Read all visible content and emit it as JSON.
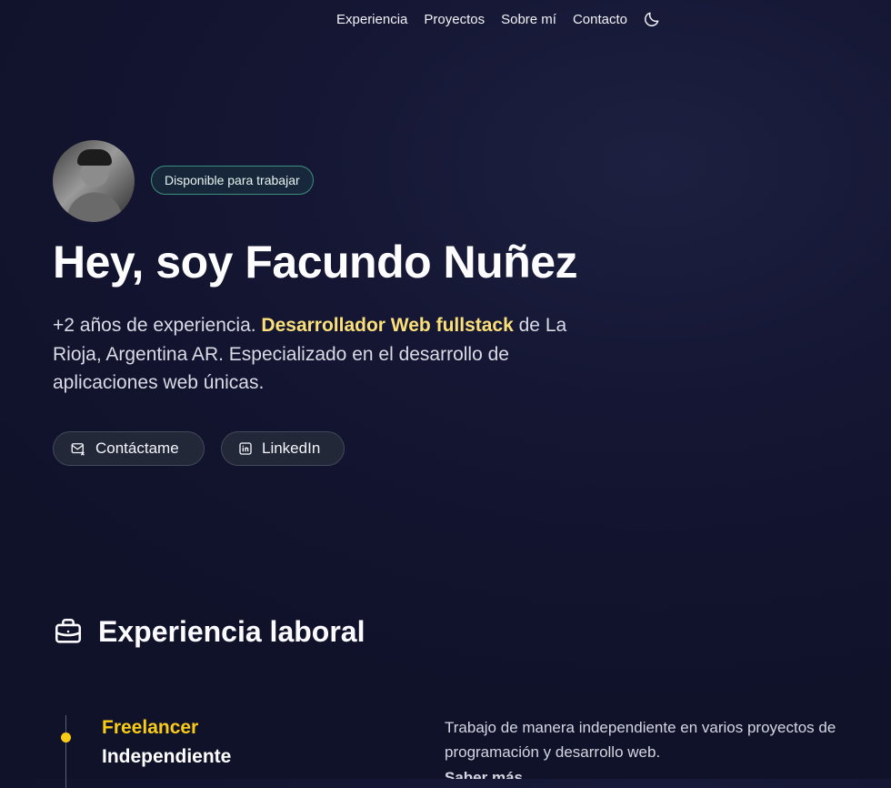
{
  "nav": {
    "items": [
      "Experiencia",
      "Proyectos",
      "Sobre mí",
      "Contacto"
    ],
    "theme_toggle_icon": "moon-icon"
  },
  "hero": {
    "avatar_icon": "profile-photo",
    "badge": "Disponible para trabajar",
    "title": "Hey, soy Facundo Nuñez",
    "intro_before": "+2 años de experiencia. ",
    "intro_highlight": "Desarrollador Web fullstack",
    "intro_after": " de La Rioja, Argentina AR. Especializado en el desarrollo de aplicaciones web únicas.",
    "buttons": {
      "contact_label": "Contáctame",
      "contact_icon": "mail-icon",
      "linkedin_label": "LinkedIn",
      "linkedin_icon": "linkedin-icon"
    }
  },
  "experience": {
    "section_title": "Experiencia laboral",
    "section_icon": "briefcase-icon",
    "jobs": [
      {
        "title": "Freelancer",
        "company": "Independiente",
        "description": "Trabajo de manera independiente en varios proyectos de programación y desarrollo web.",
        "more_text": "Saber más"
      }
    ]
  },
  "colors": {
    "accent": "#facc15",
    "highlight": "#fbe07a",
    "badge_border": "#3b8f81",
    "background": "#141633"
  }
}
